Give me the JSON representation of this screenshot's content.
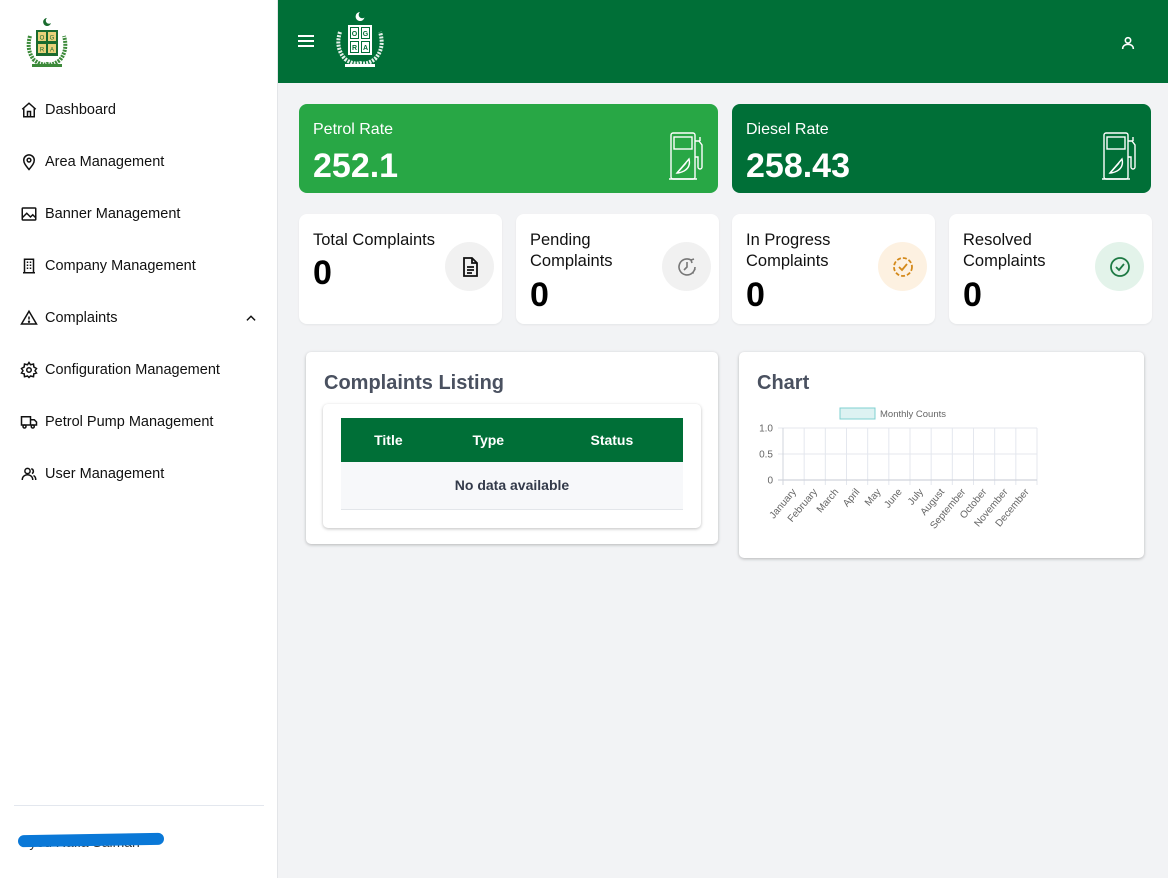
{
  "sidebar": {
    "logo": "ogra-emblem",
    "items": [
      {
        "label": "Dashboard",
        "icon": "home-icon"
      },
      {
        "label": "Area Management",
        "icon": "map-pin-icon"
      },
      {
        "label": "Banner Management",
        "icon": "image-icon"
      },
      {
        "label": "Company Management",
        "icon": "building-icon"
      },
      {
        "label": "Complaints",
        "icon": "warning-icon",
        "expanded": true
      },
      {
        "label": "Configuration Management",
        "icon": "gear-icon"
      },
      {
        "label": "Petrol Pump Management",
        "icon": "truck-icon"
      },
      {
        "label": "User Management",
        "icon": "users-icon"
      }
    ],
    "user_name": "Syed Rafia Salman"
  },
  "topbar": {
    "menu_icon": "hamburger-icon",
    "logo": "ogra-emblem",
    "user_icon": "user-icon"
  },
  "rates": {
    "petrol": {
      "label": "Petrol Rate",
      "value": "252.1"
    },
    "diesel": {
      "label": "Diesel Rate",
      "value": "258.43"
    }
  },
  "stats": [
    {
      "title": "Total Complaints",
      "value": "0",
      "icon": "document-icon"
    },
    {
      "title": "Pending Complaints",
      "value": "0",
      "icon": "clock-pending-icon"
    },
    {
      "title": "In Progress Complaints",
      "value": "0",
      "icon": "progress-check-icon"
    },
    {
      "title": "Resolved Complaints",
      "value": "0",
      "icon": "check-circle-icon"
    }
  ],
  "colors": {
    "brand_dark": "#006f37",
    "brand_light": "#28a745",
    "progress": "#d4891a",
    "resolved": "#1e8a4a"
  },
  "listing": {
    "title": "Complaints Listing",
    "columns": [
      "Title",
      "Type",
      "Status"
    ],
    "empty_text": "No data available"
  },
  "chart": {
    "title": "Chart"
  },
  "chart_data": {
    "type": "bar",
    "title": "",
    "legend": [
      "Monthly Counts"
    ],
    "legend_position": "top",
    "categories": [
      "January",
      "February",
      "March",
      "April",
      "May",
      "June",
      "July",
      "August",
      "September",
      "October",
      "November",
      "December"
    ],
    "series": [
      {
        "name": "Monthly Counts",
        "values": [
          0,
          0,
          0,
          0,
          0,
          0,
          0,
          0,
          0,
          0,
          0,
          0
        ]
      }
    ],
    "yticks": [
      "0",
      "0.5",
      "1.0"
    ],
    "ylim": [
      0,
      1
    ],
    "grid": true,
    "xlabel": "",
    "ylabel": ""
  }
}
